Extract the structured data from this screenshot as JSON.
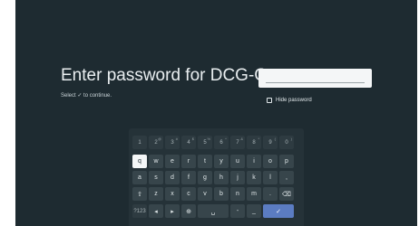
{
  "dialog": {
    "title": "Enter password for DCG-G",
    "hint": "Select ✓ to continue.",
    "password_value": "",
    "hide_password_label": "Hide password",
    "hide_password_checked": false
  },
  "keyboard": {
    "number_row": [
      {
        "main": "1",
        "alt": ""
      },
      {
        "main": "2",
        "alt": "@"
      },
      {
        "main": "3",
        "alt": "#"
      },
      {
        "main": "4",
        "alt": "$"
      },
      {
        "main": "5",
        "alt": "%"
      },
      {
        "main": "6",
        "alt": "^"
      },
      {
        "main": "7",
        "alt": "&"
      },
      {
        "main": "8",
        "alt": "*"
      },
      {
        "main": "9",
        "alt": "("
      },
      {
        "main": "0",
        "alt": ")"
      }
    ],
    "row1": [
      "q",
      "w",
      "e",
      "r",
      "t",
      "y",
      "u",
      "i",
      "o",
      "p"
    ],
    "row2": [
      "a",
      "s",
      "d",
      "f",
      "g",
      "h",
      "j",
      "k",
      "l",
      ","
    ],
    "row3": [
      "⇧",
      "z",
      "x",
      "c",
      "v",
      "b",
      "n",
      "m",
      ".",
      "⌫"
    ],
    "row4": {
      "symbols": "?123",
      "left": "◂",
      "right": "▸",
      "globe": "⊕",
      "space": "␣",
      "dash": "-",
      "underscore": "_",
      "confirm": "✓"
    },
    "selected_key": "q"
  },
  "colors": {
    "background": "#1e2b31",
    "keyboard": "#253238",
    "key": "#37454b",
    "confirm_key": "#5b7cc2",
    "selected_key": "#f4f6f7"
  }
}
